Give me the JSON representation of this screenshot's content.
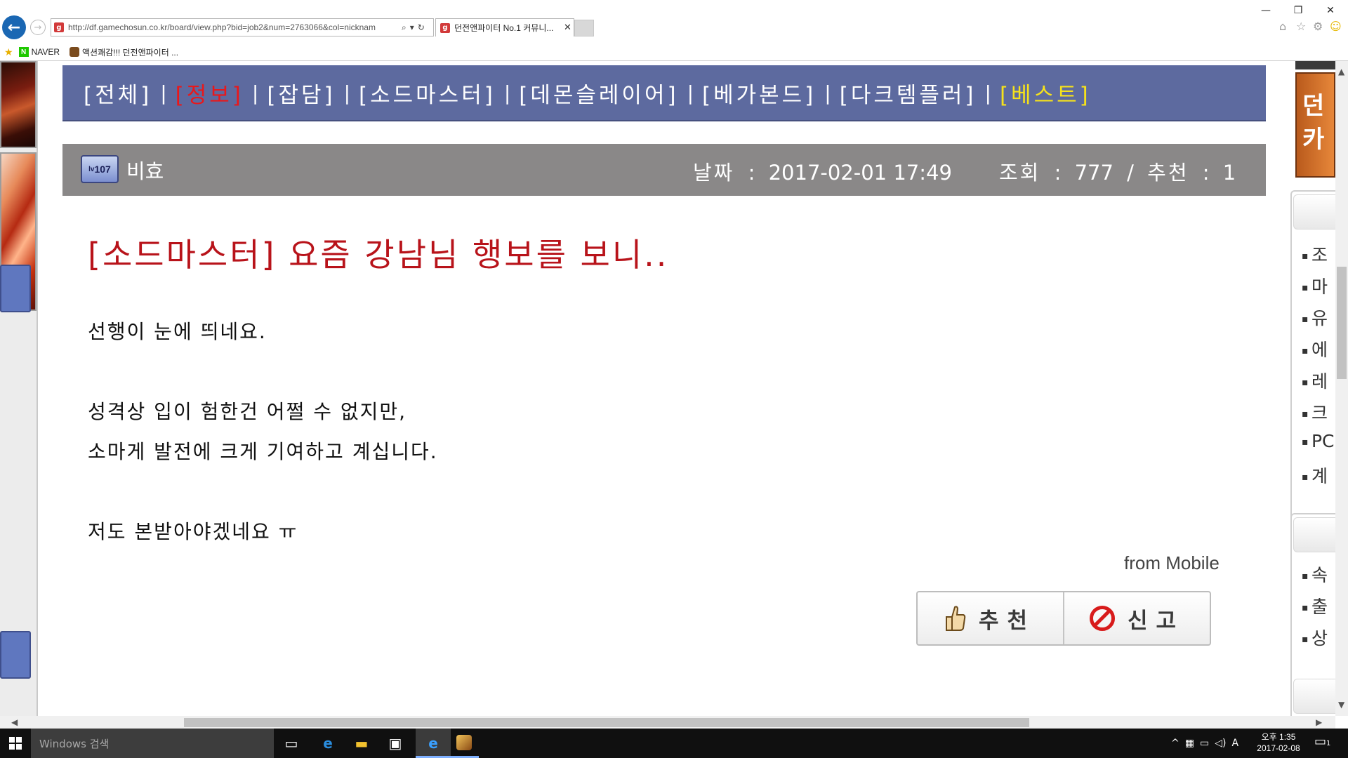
{
  "browser": {
    "url": "http://df.gamechosun.co.kr/board/view.php?bid=job2&num=2763066&col=nicknam",
    "tab_title": "던전앤파이터 No.1 커뮤니...",
    "tab_favicon": "g",
    "favorites": [
      {
        "label": "NAVER",
        "icon": "naver-icon"
      },
      {
        "label": "액션쾌감!!! 던전앤파이터 ...",
        "icon": "dnf-icon"
      }
    ],
    "window_controls": {
      "minimize": "—",
      "restore": "❐",
      "close": "✕"
    }
  },
  "board": {
    "categories": [
      {
        "label": "[전체]",
        "state": "normal"
      },
      {
        "label": "[정보]",
        "state": "active"
      },
      {
        "label": "[잡담]",
        "state": "normal"
      },
      {
        "label": "[소드마스터]",
        "state": "normal"
      },
      {
        "label": "[데몬슬레이어]",
        "state": "normal"
      },
      {
        "label": "[베가본드]",
        "state": "normal"
      },
      {
        "label": "[다크템플러]",
        "state": "normal"
      },
      {
        "label": "[베스트]",
        "state": "best"
      }
    ],
    "separator": "|",
    "colors": {
      "nav_bg": "#5d6a9f",
      "active": "#e9181b",
      "best": "#f6e21b",
      "meta_bg": "#8a8888",
      "title": "#b8131a"
    }
  },
  "post": {
    "level_badge": "107",
    "level_prefix": "lv",
    "author": "비효",
    "date_label": "날짜",
    "date_value": "2017-02-01 17:49",
    "views_label": "조회",
    "views_value": "777",
    "recommend_label": "추천",
    "recommend_value": "1",
    "colon": ":",
    "slash": "/",
    "title": "[소드마스터] 요즘 강남님 행보를 보니..",
    "body": [
      "선행이 눈에 띄네요.",
      "성격상 입이 험한건 어쩔 수 없지만,",
      "소마게 발전에 크게 기여하고 계십니다.",
      "저도 본받아야겠네요 ㅠ"
    ],
    "source": "from Mobile",
    "recommend_button": "추천",
    "report_button": "신고"
  },
  "right_panel": {
    "banner_text": [
      "던",
      "카"
    ],
    "group1": [
      "조",
      "마",
      "유",
      "에",
      "레",
      "크",
      "PC",
      "계"
    ],
    "group2": [
      "속",
      "출",
      "상"
    ]
  },
  "taskbar": {
    "search_placeholder": "Windows 검색",
    "clock_ampm_time": "오후 1:35",
    "clock_date": "2017-02-08",
    "ime": "A",
    "notification_count": "1"
  }
}
